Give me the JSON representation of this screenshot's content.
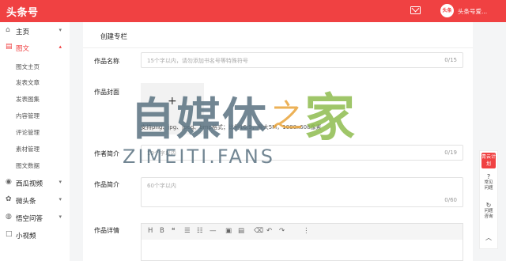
{
  "header": {
    "brand": "头条号",
    "avatar_text": "头条",
    "username": "头条号爱..."
  },
  "sidebar": {
    "items": [
      {
        "label": "主页",
        "icon": "home-icon",
        "caret": "▾"
      },
      {
        "label": "图文",
        "icon": "article-icon",
        "caret": "▴"
      },
      {
        "label": "西瓜视频",
        "icon": "video-icon",
        "caret": "▾"
      },
      {
        "label": "微头条",
        "icon": "micro-icon",
        "caret": "▾"
      },
      {
        "label": "悟空问答",
        "icon": "qa-icon",
        "caret": "▾"
      },
      {
        "label": "小视频",
        "icon": "short-video-icon",
        "caret": ""
      }
    ],
    "subitems": [
      "图文主页",
      "发表文章",
      "发表图集",
      "内容管理",
      "评论管理",
      "素材管理",
      "图文数据"
    ]
  },
  "main": {
    "title": "创建专栏",
    "name_label": "作品名称",
    "name_placeholder": "15个字以内，请勿添加书名号等特殊符号",
    "name_count": "0/15",
    "cover_label": "作品封面",
    "cover_plus": "+",
    "cover_note": "支持png、jpg、jpeg、bmp格式；比例16:9，最大5M，1080x608像素",
    "author_label": "作者简介",
    "author_placeholder": "19个字以内",
    "author_count": "0/19",
    "intro_label": "作品简介",
    "intro_placeholder": "60个字以内",
    "intro_count": "0/60",
    "detail_label": "作品详情",
    "toolbar": [
      "H",
      "B",
      "❝",
      "☰",
      "☷",
      "—",
      "▣",
      "▤",
      "⌫",
      "↶",
      "↷",
      "⋮"
    ]
  },
  "float": {
    "badge": "青云计划",
    "items": [
      {
        "icon": "?",
        "label1": "常见",
        "label2": "问题"
      },
      {
        "icon": "↻",
        "label1": "问题",
        "label2": "咨询"
      },
      {
        "icon": "︿",
        "label1": "",
        "label2": ""
      }
    ]
  },
  "watermark": {
    "cn1": "自媒体",
    "zhi": "之",
    "jia": "家",
    "en": "ZIMEITI.FANS"
  },
  "colors": {
    "accent": "#f04142",
    "bg": "#f4f5f6"
  }
}
